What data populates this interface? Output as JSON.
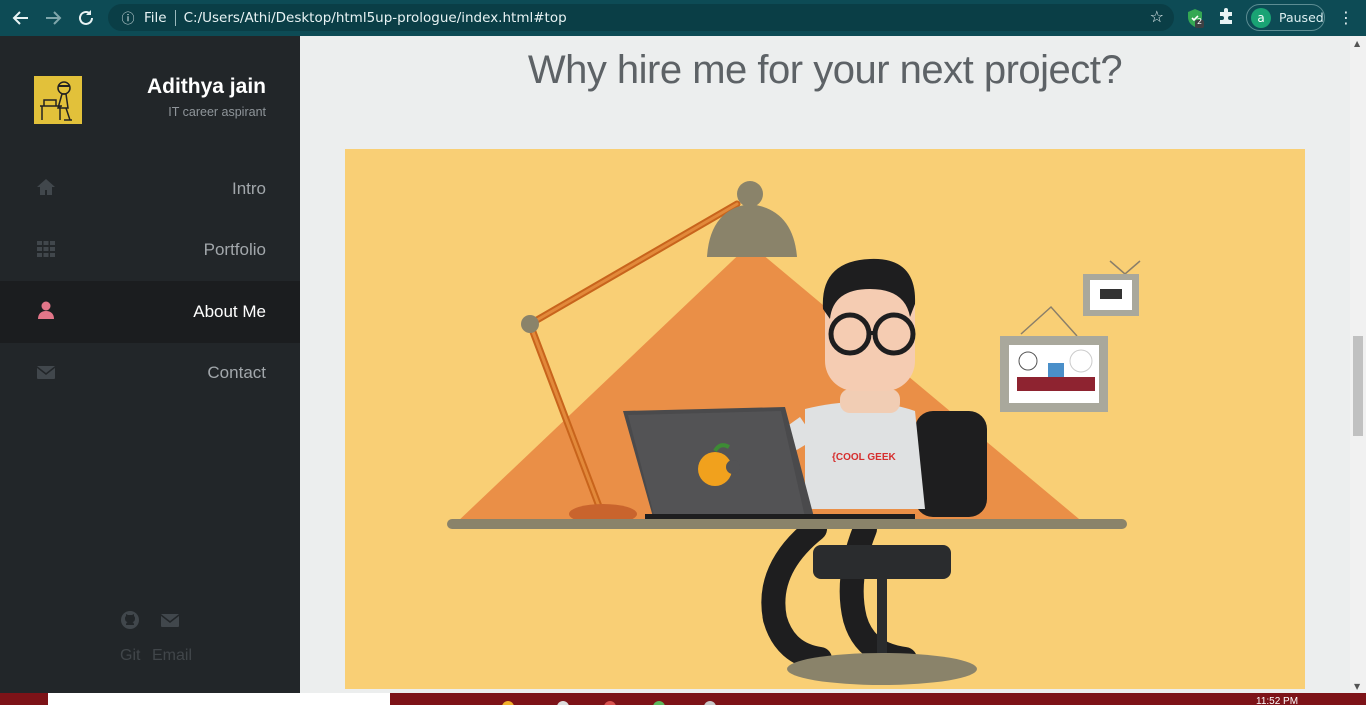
{
  "browser": {
    "url_scheme_label": "File",
    "url": "C:/Users/Athi/Desktop/html5up-prologue/index.html#top",
    "extension_badge": "2",
    "profile_initial": "a",
    "profile_status": "Paused"
  },
  "sidebar": {
    "site_name": "Adithya jain",
    "tagline": "IT career aspirant",
    "items": [
      {
        "label": "Intro",
        "icon": "home-icon",
        "active": false
      },
      {
        "label": "Portfolio",
        "icon": "grid-icon",
        "active": false
      },
      {
        "label": "About Me",
        "icon": "user-icon",
        "active": true
      },
      {
        "label": "Contact",
        "icon": "envelope-icon",
        "active": false
      }
    ],
    "social": {
      "git_label": "Git",
      "email_label": "Email"
    }
  },
  "main": {
    "heading": "Why hire me for your next project?",
    "hero_shirt_text": "{COOL GEEK"
  },
  "taskbar": {
    "time": "11:52 PM"
  },
  "colors": {
    "browser_bar": "#0d4b55",
    "sidebar_bg": "#222629",
    "active_icon": "#e27689",
    "hero_bg": "#f9cf75",
    "taskbar": "#7d1318"
  }
}
